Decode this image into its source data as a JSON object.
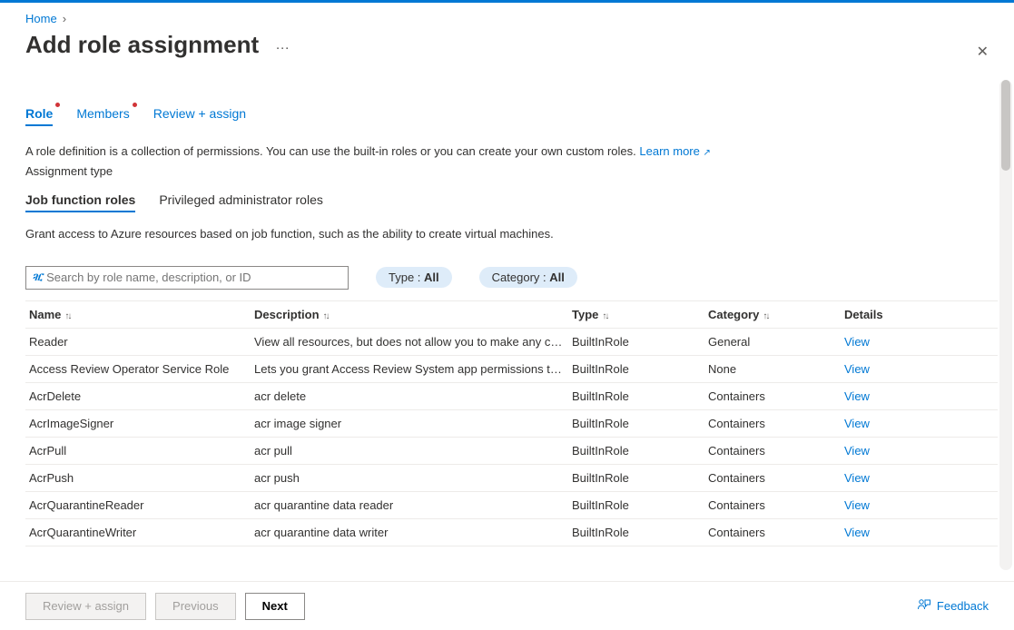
{
  "breadcrumb": {
    "home": "Home"
  },
  "page_title": "Add role assignment",
  "tabs": [
    {
      "label": "Role",
      "active": true,
      "dot": true
    },
    {
      "label": "Members",
      "active": false,
      "dot": true
    },
    {
      "label": "Review + assign",
      "active": false,
      "dot": false
    }
  ],
  "intro_text": "A role definition is a collection of permissions. You can use the built-in roles or you can create your own custom roles.",
  "learn_more": "Learn more",
  "assignment_type_label": "Assignment type",
  "subtabs": [
    {
      "label": "Job function roles",
      "active": true
    },
    {
      "label": "Privileged administrator roles",
      "active": false
    }
  ],
  "subtab_description": "Grant access to Azure resources based on job function, such as the ability to create virtual machines.",
  "search_placeholder": "Search by role name, description, or ID",
  "filters": {
    "type_prefix": "Type : ",
    "type_value": "All",
    "category_prefix": "Category : ",
    "category_value": "All"
  },
  "columns": {
    "name": "Name",
    "description": "Description",
    "type": "Type",
    "category": "Category",
    "details": "Details"
  },
  "view_label": "View",
  "rows": [
    {
      "name": "Reader",
      "desc": "View all resources, but does not allow you to make any ch…",
      "type": "BuiltInRole",
      "category": "General"
    },
    {
      "name": "Access Review Operator Service Role",
      "desc": "Lets you grant Access Review System app permissions to …",
      "type": "BuiltInRole",
      "category": "None"
    },
    {
      "name": "AcrDelete",
      "desc": "acr delete",
      "type": "BuiltInRole",
      "category": "Containers"
    },
    {
      "name": "AcrImageSigner",
      "desc": "acr image signer",
      "type": "BuiltInRole",
      "category": "Containers"
    },
    {
      "name": "AcrPull",
      "desc": "acr pull",
      "type": "BuiltInRole",
      "category": "Containers"
    },
    {
      "name": "AcrPush",
      "desc": "acr push",
      "type": "BuiltInRole",
      "category": "Containers"
    },
    {
      "name": "AcrQuarantineReader",
      "desc": "acr quarantine data reader",
      "type": "BuiltInRole",
      "category": "Containers"
    },
    {
      "name": "AcrQuarantineWriter",
      "desc": "acr quarantine data writer",
      "type": "BuiltInRole",
      "category": "Containers"
    }
  ],
  "footer": {
    "review": "Review + assign",
    "previous": "Previous",
    "next": "Next",
    "feedback": "Feedback"
  }
}
